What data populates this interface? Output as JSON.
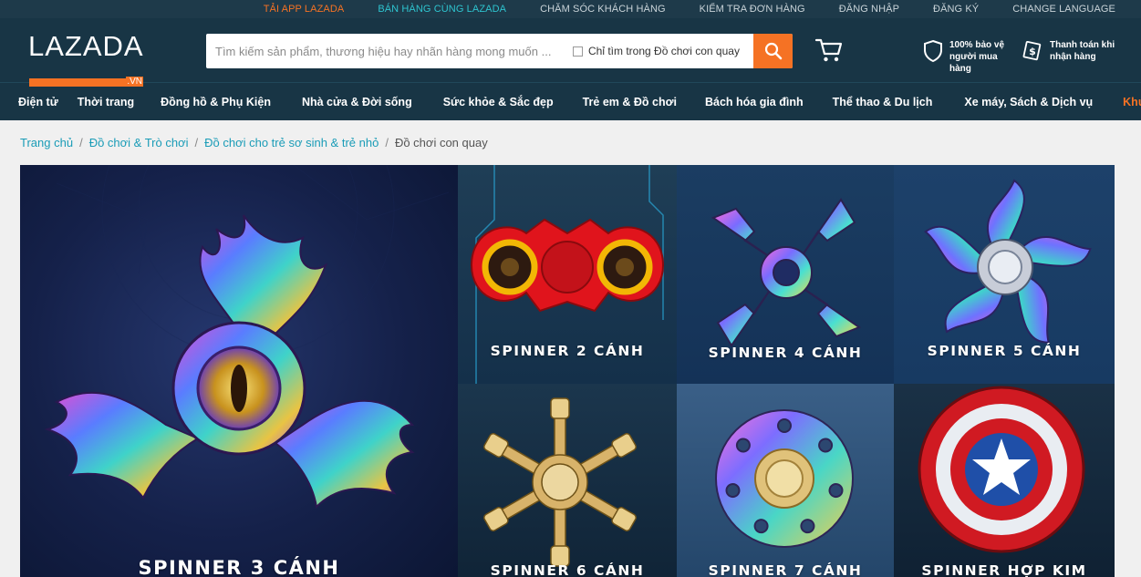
{
  "topbar": {
    "links": [
      "TẢI APP LAZADA",
      "BÁN HÀNG CÙNG LAZADA",
      "CHĂM SÓC KHÁCH HÀNG",
      "KIỂM TRA ĐƠN HÀNG",
      "ĐĂNG NHẬP",
      "ĐĂNG KÝ",
      "CHANGE LANGUAGE"
    ]
  },
  "header": {
    "logo_text": "LAZADA",
    "logo_suffix": ".VN",
    "search_placeholder": "Tìm kiếm sản phẩm, thương hiệu hay nhãn hàng mong muốn ...",
    "search_scope_label": "Chỉ tìm trong Đồ chơi con quay",
    "assurance_1": "100% bảo vệ người mua hàng",
    "assurance_2": "Thanh toán khi nhận hàng"
  },
  "nav": {
    "items": [
      "Điện tử",
      "Thời trang",
      "Đồng hồ & Phụ Kiện",
      "Nhà cửa & Đời sống",
      "Sức khỏe & Sắc đẹp",
      "Trẻ em & Đồ chơi",
      "Bách hóa gia đình",
      "Thể thao & Du lịch",
      "Xe máy, Sách & Dịch vụ",
      "Khuyến mãi"
    ]
  },
  "breadcrumb": {
    "items": [
      "Trang chủ",
      "Đồ chơi & Trò chơi",
      "Đồ chơi cho trẻ sơ sinh & trẻ nhỏ"
    ],
    "current": "Đồ chơi con quay"
  },
  "banner": {
    "tiles": [
      "SPINNER 3 CÁNH",
      "SPINNER 2 CÁNH",
      "SPINNER 4 CÁNH",
      "SPINNER 5 CÁNH",
      "SPINNER 6 CÁNH",
      "SPINNER 7 CÁNH",
      "SPINNER HỢP KIM"
    ]
  },
  "colors": {
    "brand_orange": "#f57224",
    "header_navy": "#183545",
    "link_teal": "#1a9cb7"
  },
  "icons": [
    "search-icon",
    "cart-icon",
    "shield-icon",
    "cash-icon",
    "checkbox"
  ]
}
